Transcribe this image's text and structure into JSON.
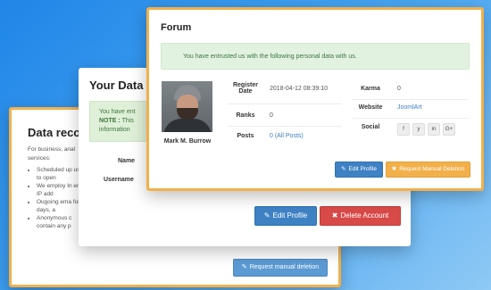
{
  "data_records": {
    "title": "Data record",
    "intro": "For business, anal services:",
    "bullets": [
      "Scheduled up used to open",
      "We employ In email, IP add",
      "Ougoing ema for 90 days, a",
      "Anonymous c contain any p"
    ],
    "request_button": "Request manual deletion"
  },
  "your_data": {
    "title": "Your Data",
    "alert_line1": "You have ent",
    "alert_note_label": "NOTE :",
    "alert_line2": "This",
    "alert_line3": "information",
    "labels": {
      "name": "Name",
      "username": "Username"
    },
    "edit_button": "Edit Profile",
    "delete_button": "Delete Account"
  },
  "forum": {
    "title": "Forum",
    "alert": "You have entrusted us with the following personal data with us.",
    "user_name": "Mark M. Burrow",
    "fields": {
      "register_label_1": "Register",
      "register_label_2": "Date",
      "register_value": "2018-04-12 08:39:10",
      "ranks_label": "Ranks",
      "ranks_value": "0",
      "posts_label": "Posts",
      "posts_value": "0 (All Posts)",
      "karma_label": "Karma",
      "karma_value": "0",
      "website_label": "Website",
      "website_value": "JoomlArt",
      "social_label": "Social"
    },
    "social": [
      "f",
      "y",
      "in",
      "G+"
    ],
    "edit_button": "Edit Profile",
    "request_button": "Request Manual Deletion"
  },
  "colors": {
    "accent_blue": "#3f82c4",
    "danger_red": "#d84a48",
    "warning_orange": "#f2b04a",
    "success_bg": "#dff0d8"
  }
}
